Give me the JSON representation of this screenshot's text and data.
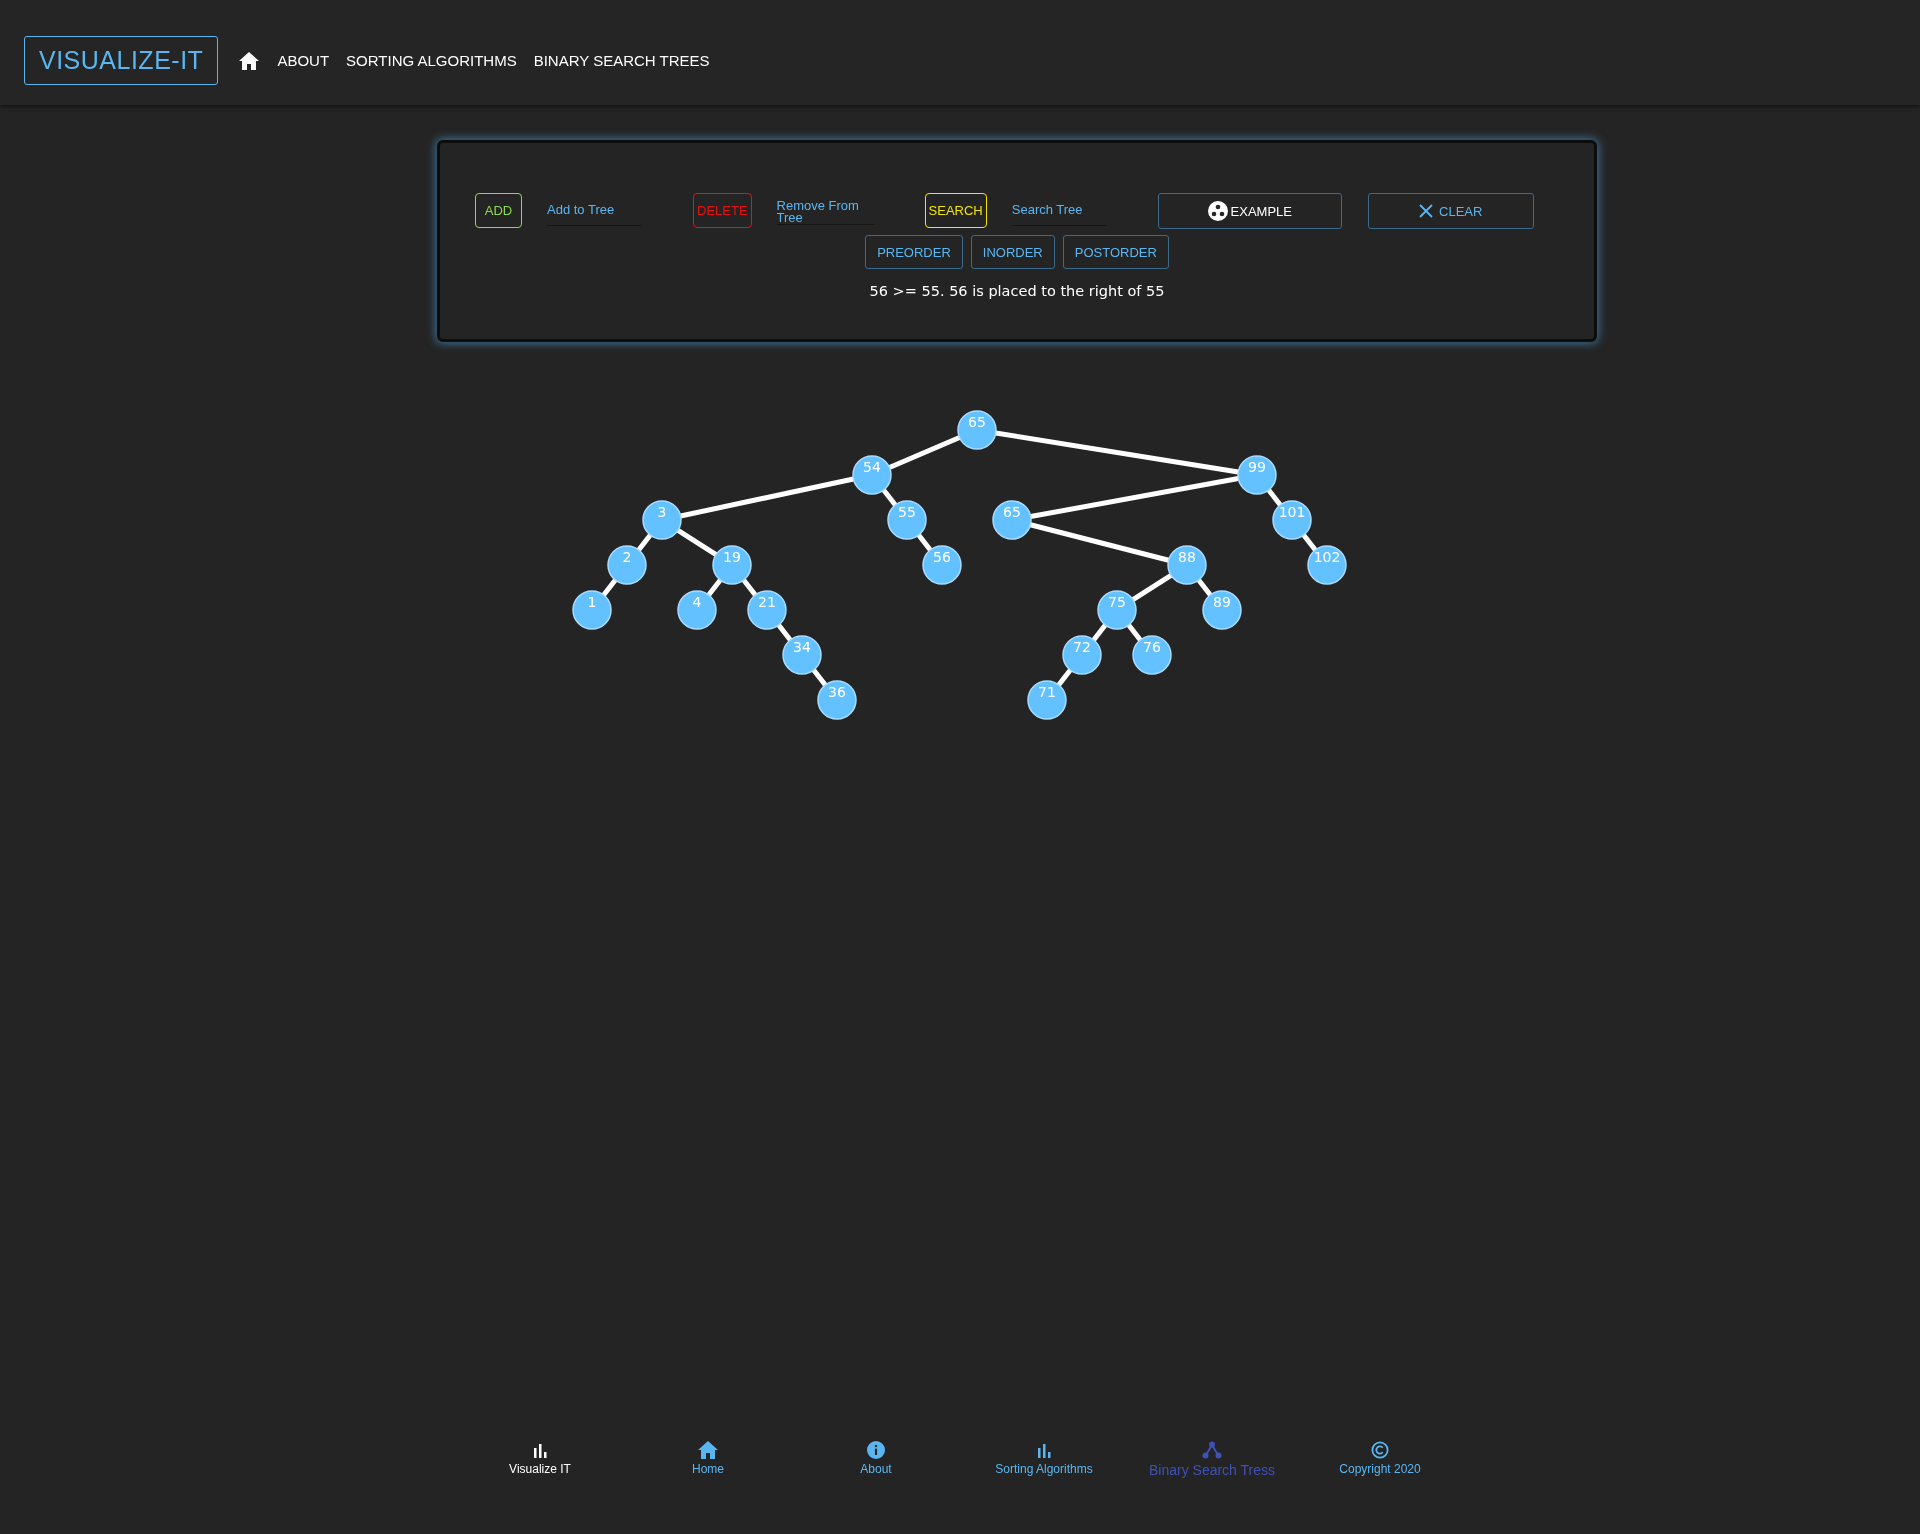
{
  "header": {
    "logo": "VISUALIZE-IT",
    "nav": [
      "ABOUT",
      "SORTING ALGORITHMS",
      "BINARY SEARCH TREES"
    ]
  },
  "controls": {
    "operations": [
      {
        "button": "ADD",
        "color": "#8bd94a",
        "placeholder": "Add to Tree"
      },
      {
        "button": "DELETE",
        "color": "#e81010",
        "placeholder": "Remove From Tree"
      },
      {
        "button": "SEARCH",
        "color": "#f2e20c",
        "placeholder": "Search Tree"
      }
    ],
    "example_button": "EXAMPLE",
    "clear_button": "CLEAR",
    "traversals": [
      "PREORDER",
      "INORDER",
      "POSTORDER"
    ],
    "message": "56 >= 55. 56 is placed to the right of 55"
  },
  "tree": {
    "value": "65",
    "children": [
      {
        "value": "54",
        "kind": "left",
        "children": [
          {
            "value": "3",
            "kind": "left",
            "children": [
              {
                "value": "2",
                "kind": "left",
                "children": [
                  {
                    "value": "1",
                    "kind": "left"
                  }
                ]
              },
              {
                "value": "19",
                "kind": "right",
                "children": [
                  {
                    "value": "4",
                    "kind": "left"
                  },
                  {
                    "value": "21",
                    "kind": "right",
                    "children": [
                      {
                        "value": "34",
                        "kind": "right",
                        "children": [
                          {
                            "value": "36",
                            "kind": "right"
                          }
                        ]
                      }
                    ]
                  }
                ]
              }
            ]
          },
          {
            "value": "55",
            "kind": "right",
            "children": [
              {
                "value": "56",
                "kind": "right"
              }
            ]
          }
        ]
      },
      {
        "value": "99",
        "kind": "right",
        "children": [
          {
            "value": "65",
            "kind": "left",
            "children": [
              {
                "value": "88",
                "kind": "right",
                "children": [
                  {
                    "value": "75",
                    "kind": "left",
                    "children": [
                      {
                        "value": "72",
                        "kind": "left",
                        "children": [
                          {
                            "value": "71",
                            "kind": "left"
                          }
                        ]
                      },
                      {
                        "value": "76",
                        "kind": "right"
                      }
                    ]
                  },
                  {
                    "value": "89",
                    "kind": "right"
                  }
                ]
              }
            ]
          },
          {
            "value": "101",
            "kind": "right",
            "children": [
              {
                "value": "102",
                "kind": "right"
              }
            ]
          }
        ]
      }
    ]
  },
  "footer": [
    {
      "label": "Visualize IT",
      "kind": "bars",
      "selected": false
    },
    {
      "label": "Home",
      "kind": "home",
      "selected": false
    },
    {
      "label": "About",
      "kind": "info",
      "selected": false
    },
    {
      "label": "Sorting Algorithms",
      "kind": "bars",
      "selected": false
    },
    {
      "label": "Binary Search Tress",
      "kind": "tree",
      "selected": true
    },
    {
      "label": "Copyright 2020",
      "kind": "copyright",
      "selected": false
    }
  ]
}
